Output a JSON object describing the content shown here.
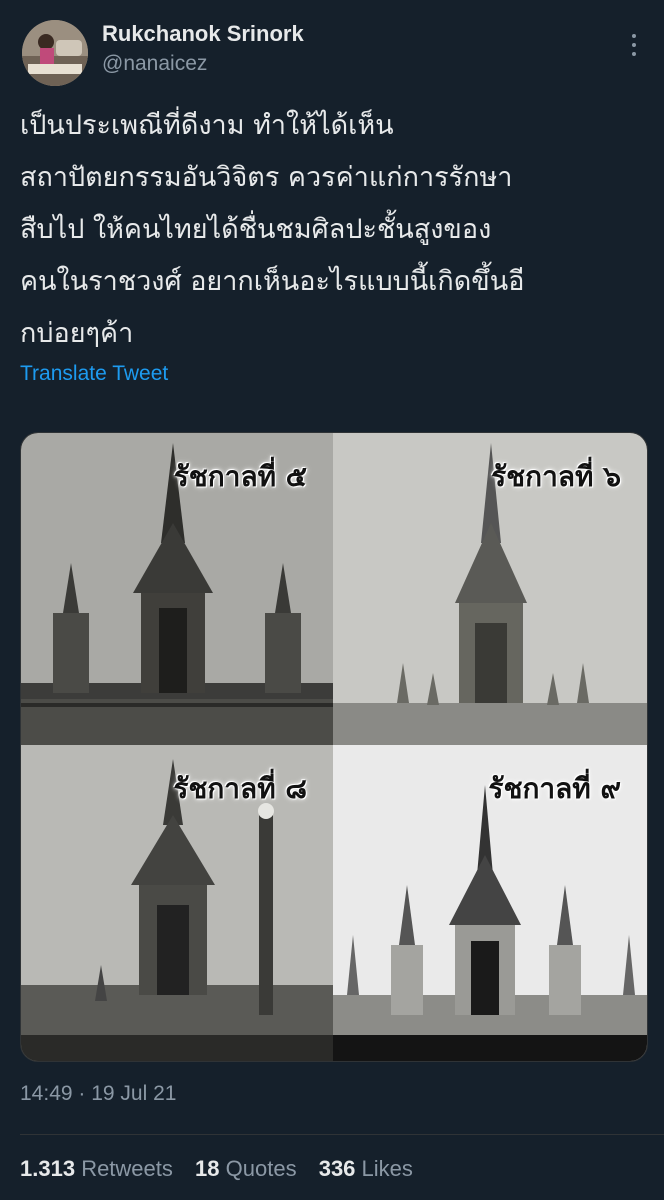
{
  "tweet": {
    "author": {
      "display_name": "Rukchanok Srinork",
      "handle": "@nanaicez"
    },
    "text": "เป็นประเพณีที่ดีงาม ทำให้ได้เห็น\nสถาปัตยกรรมอันวิจิตร ควรค่าแก่การรักษา\nสืบไป ให้คนไทยได้ชื่นชมศิลปะชั้นสูงของ\nคนในราชวงศ์ อยากเห็นอะไรแบบนี้เกิดขึ้นอี\nกบ่อยๆค้า",
    "translate_link": "Translate Tweet",
    "media": [
      {
        "label": "รัชกาลที่ ๕"
      },
      {
        "label": "รัชกาลที่ ๖"
      },
      {
        "label": "รัชกาลที่ ๘"
      },
      {
        "label": "รัชกาลที่ ๙"
      }
    ],
    "timestamp": "14:49 · 19 Jul 21",
    "stats": {
      "retweets": {
        "count": "1.313",
        "label": "Retweets"
      },
      "quotes": {
        "count": "18",
        "label": "Quotes"
      },
      "likes": {
        "count": "336",
        "label": "Likes"
      }
    }
  },
  "colors": {
    "background": "#15202b",
    "text_primary": "#e7e9ea",
    "text_secondary": "#8b98a5",
    "link": "#1d9bf0"
  },
  "icons": {
    "more": "more-dots-icon"
  }
}
